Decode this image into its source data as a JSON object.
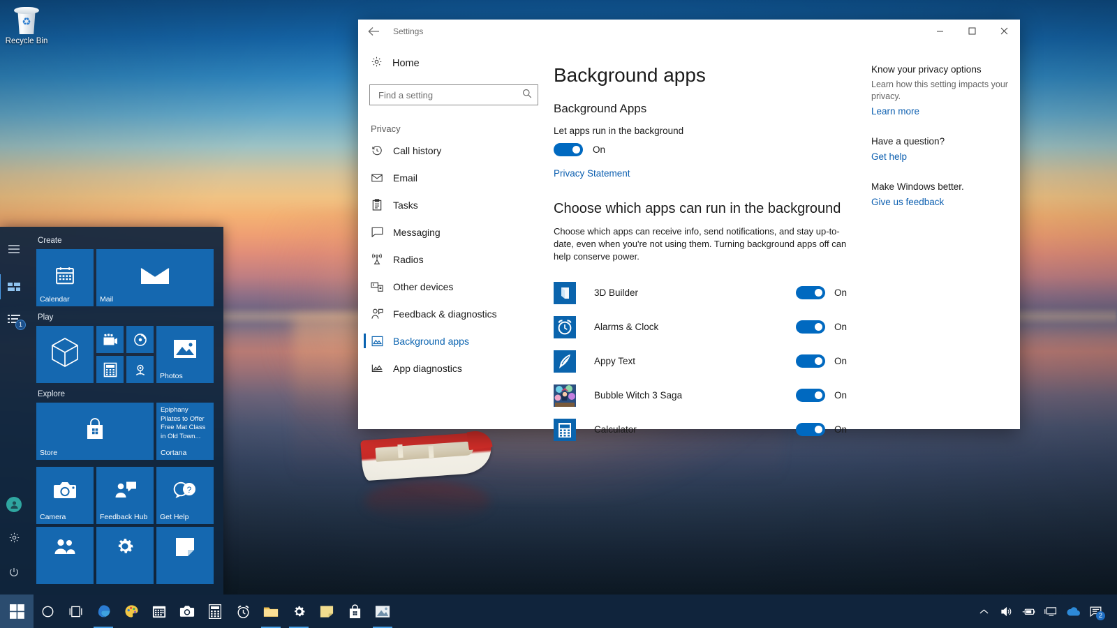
{
  "desktop": {
    "recycle_bin_label": "Recycle Bin"
  },
  "start_menu": {
    "rail": {
      "menu_icon": "hamburger-icon",
      "tiles_icon": "tiles-icon",
      "list_icon": "all-apps-list-icon",
      "list_badge": "1",
      "avatar_icon": "user-avatar-icon",
      "settings_icon": "gear-icon",
      "power_icon": "power-icon"
    },
    "groups": [
      {
        "label": "Create",
        "tiles": [
          {
            "name": "Calendar",
            "icon": "calendar-icon",
            "size": "med"
          },
          {
            "name": "Mail",
            "icon": "mail-icon",
            "size": "wide"
          }
        ]
      },
      {
        "label": "Play",
        "tiles": [
          {
            "name": "",
            "icon": "3d-builder-cube-icon",
            "size": "med"
          },
          {
            "name": "",
            "icon": "movies-tv-icon",
            "size": "sm"
          },
          {
            "name": "",
            "icon": "groove-music-icon",
            "size": "sm"
          },
          {
            "name": "",
            "icon": "calculator-icon",
            "size": "sm"
          },
          {
            "name": "",
            "icon": "camera-icon",
            "size": "sm"
          },
          {
            "name": "Photos",
            "icon": "photos-icon",
            "size": "med"
          }
        ]
      },
      {
        "label": "Explore",
        "tiles": [
          {
            "name": "Store",
            "icon": "store-bag-icon",
            "size": "wide"
          },
          {
            "name": "Cortana",
            "icon": "cortana-news-tile",
            "size": "med",
            "text": "Epiphany Pilates to Offer Free Mat Class in Old Town..."
          }
        ]
      },
      {
        "label": "",
        "tiles": [
          {
            "name": "Camera",
            "icon": "camera-icon",
            "size": "med"
          },
          {
            "name": "Feedback Hub",
            "icon": "feedback-hub-icon",
            "size": "med"
          },
          {
            "name": "Get Help",
            "icon": "get-help-icon",
            "size": "med"
          },
          {
            "name": "",
            "icon": "people-icon",
            "size": "med"
          },
          {
            "name": "",
            "icon": "settings-gear-icon",
            "size": "med"
          },
          {
            "name": "",
            "icon": "sticky-notes-icon",
            "size": "med"
          }
        ]
      }
    ]
  },
  "settings_window": {
    "titlebar": {
      "back_icon": "back-arrow-icon",
      "title": "Settings",
      "minimize_label": "—",
      "maximize_label": "☐",
      "close_label": "✕"
    },
    "nav": {
      "home_label": "Home",
      "home_icon": "gear-icon",
      "search": {
        "placeholder": "Find a setting",
        "value": "",
        "icon": "search-icon"
      },
      "group_label": "Privacy",
      "items": [
        {
          "label": "Call history",
          "icon": "call-history-icon",
          "active": false
        },
        {
          "label": "Email",
          "icon": "email-icon",
          "active": false
        },
        {
          "label": "Tasks",
          "icon": "tasks-clipboard-icon",
          "active": false
        },
        {
          "label": "Messaging",
          "icon": "messaging-icon",
          "active": false
        },
        {
          "label": "Radios",
          "icon": "radios-antenna-icon",
          "active": false
        },
        {
          "label": "Other devices",
          "icon": "other-devices-icon",
          "active": false
        },
        {
          "label": "Feedback & diagnostics",
          "icon": "feedback-diagnostics-icon",
          "active": false
        },
        {
          "label": "Background apps",
          "icon": "background-apps-icon",
          "active": true
        },
        {
          "label": "App diagnostics",
          "icon": "app-diagnostics-icon",
          "active": false
        }
      ]
    },
    "main": {
      "page_title": "Background apps",
      "section_title": "Background Apps",
      "master_toggle": {
        "label": "Let apps run in the background",
        "state": "On",
        "on": true
      },
      "privacy_statement_link": "Privacy Statement",
      "choose_heading": "Choose which apps can run in the background",
      "choose_description": "Choose which apps can receive info, send notifications, and stay up-to-date, even when you're not using them. Turning background apps off can help conserve power.",
      "apps": [
        {
          "name": "3D Builder",
          "icon": "3d-builder-icon",
          "state": "On",
          "on": true
        },
        {
          "name": "Alarms & Clock",
          "icon": "alarms-clock-icon",
          "state": "On",
          "on": true
        },
        {
          "name": "Appy Text",
          "icon": "appy-text-icon",
          "state": "On",
          "on": true
        },
        {
          "name": "Bubble Witch 3 Saga",
          "icon": "bubble-witch-icon",
          "state": "On",
          "on": true
        },
        {
          "name": "Calculator",
          "icon": "calculator-icon",
          "state": "On",
          "on": true
        }
      ]
    },
    "side_panel": {
      "privacy_heading": "Know your privacy options",
      "privacy_text": "Learn how this setting impacts your privacy.",
      "learn_more_link": "Learn more",
      "question_heading": "Have a question?",
      "get_help_link": "Get help",
      "better_heading": "Make Windows better.",
      "feedback_link": "Give us feedback"
    }
  },
  "taskbar": {
    "start_icon": "windows-start-icon",
    "items": [
      {
        "icon": "cortana-circle-icon",
        "name": "cortana",
        "running": false
      },
      {
        "icon": "task-view-icon",
        "name": "task-view",
        "running": false
      },
      {
        "icon": "edge-icon",
        "name": "microsoft-edge",
        "running": true
      },
      {
        "icon": "paint-3d-icon",
        "name": "paint-3d",
        "running": false
      },
      {
        "icon": "calendar-icon",
        "name": "calendar",
        "running": false
      },
      {
        "icon": "camera-icon",
        "name": "camera",
        "running": false
      },
      {
        "icon": "calculator-icon",
        "name": "calculator",
        "running": false
      },
      {
        "icon": "alarms-clock-icon",
        "name": "alarms-clock",
        "running": false
      },
      {
        "icon": "file-explorer-icon",
        "name": "file-explorer",
        "running": true
      },
      {
        "icon": "settings-gear-icon",
        "name": "settings",
        "running": true
      },
      {
        "icon": "sticky-notes-icon",
        "name": "sticky-notes",
        "running": false
      },
      {
        "icon": "store-icon",
        "name": "microsoft-store",
        "running": false
      },
      {
        "icon": "photos-icon",
        "name": "photos",
        "running": true
      }
    ],
    "tray": [
      {
        "icon": "chevron-up-icon",
        "name": "show-hidden-icons"
      },
      {
        "icon": "speaker-icon",
        "name": "volume"
      },
      {
        "icon": "battery-icon",
        "name": "battery"
      },
      {
        "icon": "network-display-icon",
        "name": "network"
      },
      {
        "icon": "onedrive-cloud-icon",
        "name": "onedrive"
      },
      {
        "icon": "action-center-icon",
        "name": "action-center",
        "badge": "2"
      }
    ]
  },
  "colors": {
    "accent_blue": "#0069c0",
    "link_blue": "#0c5fb0",
    "tile_blue": "#1568b0",
    "taskbar": "#10243c",
    "start_bg": "#10263d"
  }
}
